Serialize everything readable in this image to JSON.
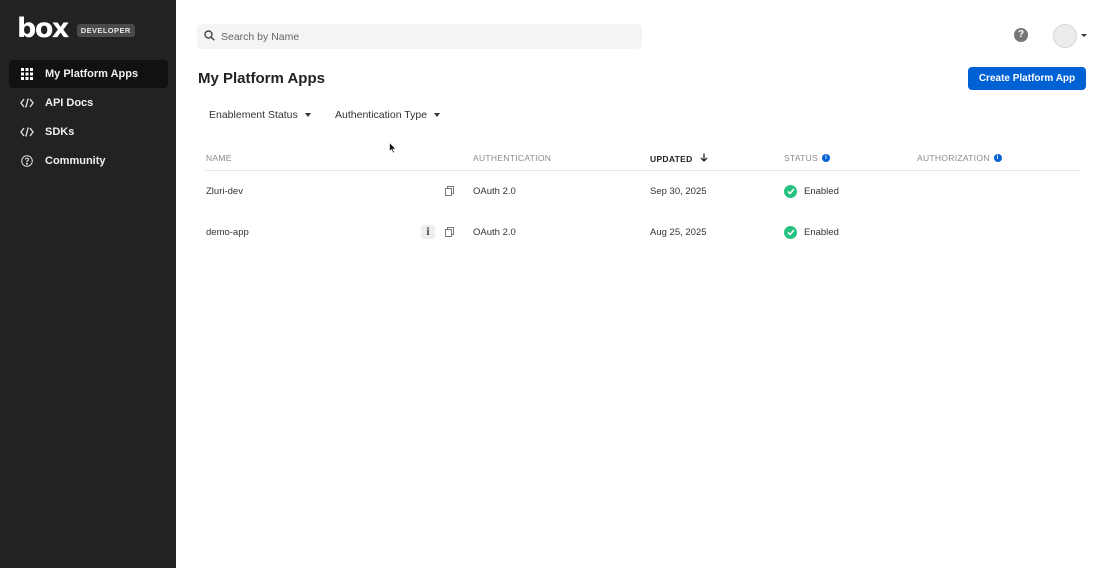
{
  "sidebar": {
    "logo": "box",
    "badge": "DEVELOPER",
    "items": [
      {
        "label": "My Platform Apps",
        "icon": "grid-icon",
        "active": true
      },
      {
        "label": "API Docs",
        "icon": "code-icon",
        "active": false
      },
      {
        "label": "SDKs",
        "icon": "code-icon",
        "active": false
      },
      {
        "label": "Community",
        "icon": "question-circle-icon",
        "active": false
      }
    ]
  },
  "topbar": {
    "search_placeholder": "Search by Name",
    "help_icon": "?"
  },
  "main": {
    "title": "My Platform Apps",
    "create_button": "Create Platform App",
    "filters": [
      "Enablement Status",
      "Authentication Type"
    ]
  },
  "table": {
    "columns": {
      "name": "NAME",
      "authentication": "AUTHENTICATION",
      "updated": "UPDATED",
      "status": "STATUS",
      "authorization": "AUTHORIZATION"
    },
    "sorted_column": "updated",
    "sort_direction": "descending",
    "rows": [
      {
        "name": "Zluri-dev",
        "authentication": "OAuth 2.0",
        "updated": "Sep 30, 2025",
        "status": "Enabled",
        "authorization": ""
      },
      {
        "name": "demo-app",
        "authentication": "OAuth 2.0",
        "updated": "Aug 25, 2025",
        "status": "Enabled",
        "authorization": ""
      }
    ]
  },
  "colors": {
    "sidebar_bg": "#222222",
    "accent": "#0061d5",
    "status_enabled": "#26c281"
  }
}
